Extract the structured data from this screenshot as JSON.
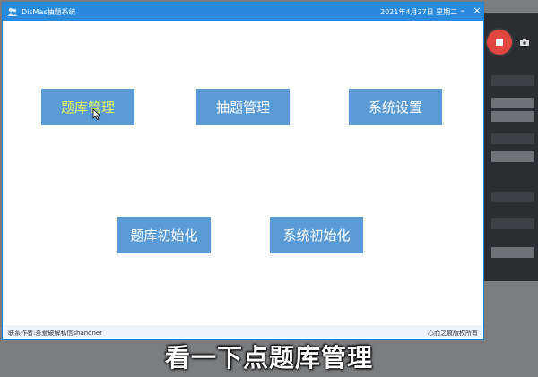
{
  "window": {
    "title": "DisMas抽题系统",
    "datetime": "2021年4月27日 星期二",
    "minimize": "–",
    "close": "×"
  },
  "main": {
    "buttons": {
      "tiku": "题库管理",
      "chouti": "抽题管理",
      "xitong": "系统设置",
      "tiku_init": "题库初始化",
      "xitong_init": "系统初始化"
    }
  },
  "statusbar": {
    "left": "联系作者:吾爱破解私信shanoner",
    "right": "心而之痕版权所有"
  },
  "subtitle": "看一下点题库管理",
  "colors": {
    "titlebar": "#2a8bdc",
    "button": "#5b9bd5",
    "hover_text": "#e8f560",
    "record": "#e2473f"
  }
}
